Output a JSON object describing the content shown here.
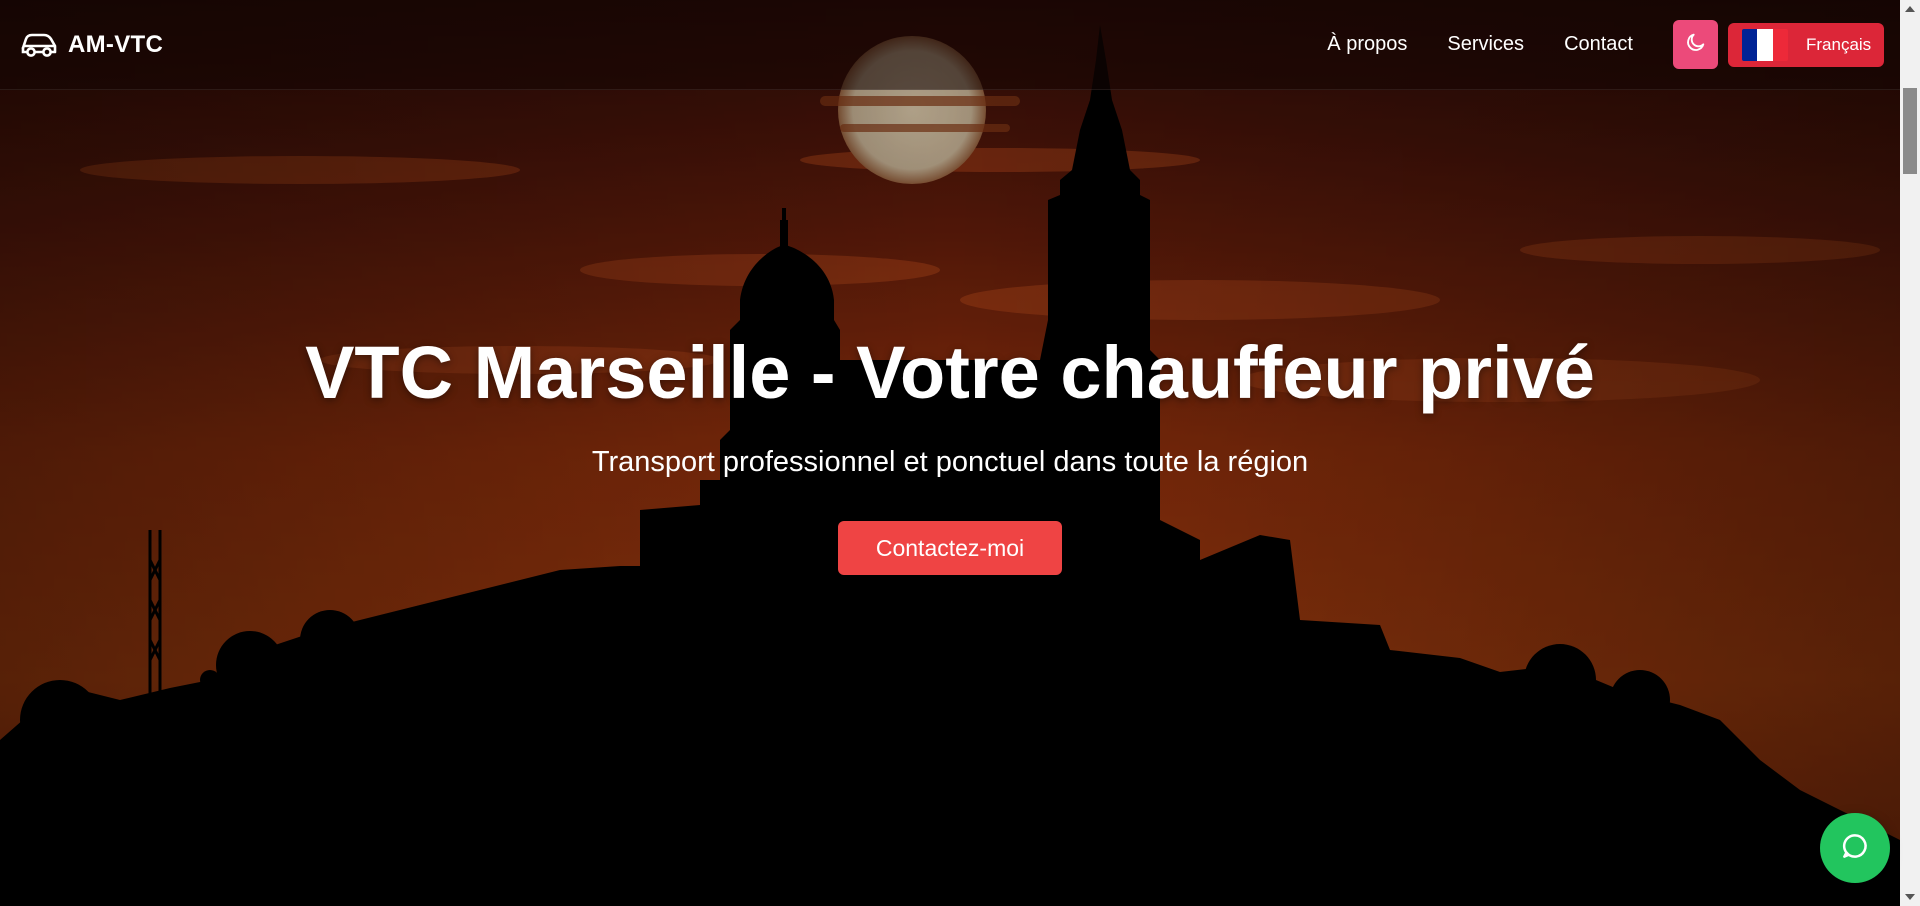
{
  "navbar": {
    "brand": "AM-VTC",
    "brand_icon": "car-icon",
    "links": [
      {
        "label": "À propos"
      },
      {
        "label": "Services"
      },
      {
        "label": "Contact"
      }
    ],
    "theme_toggle_icon": "moon-icon",
    "language": {
      "label": "Français",
      "flag_icon": "france-flag-icon",
      "flag_colors": [
        "#002395",
        "#ffffff",
        "#ed2939"
      ]
    }
  },
  "hero": {
    "title": "VTC Marseille - Votre chauffeur privé",
    "subtitle": "Transport professionnel et ponctuel dans toute la région",
    "cta_label": "Contactez-moi"
  },
  "chat_button_icon": "chat-bubble-icon",
  "colors": {
    "accent": "#ef4444",
    "theme_toggle": "#ec4a7a",
    "language_button": "#dc2638",
    "chat_button": "#22c55e"
  }
}
